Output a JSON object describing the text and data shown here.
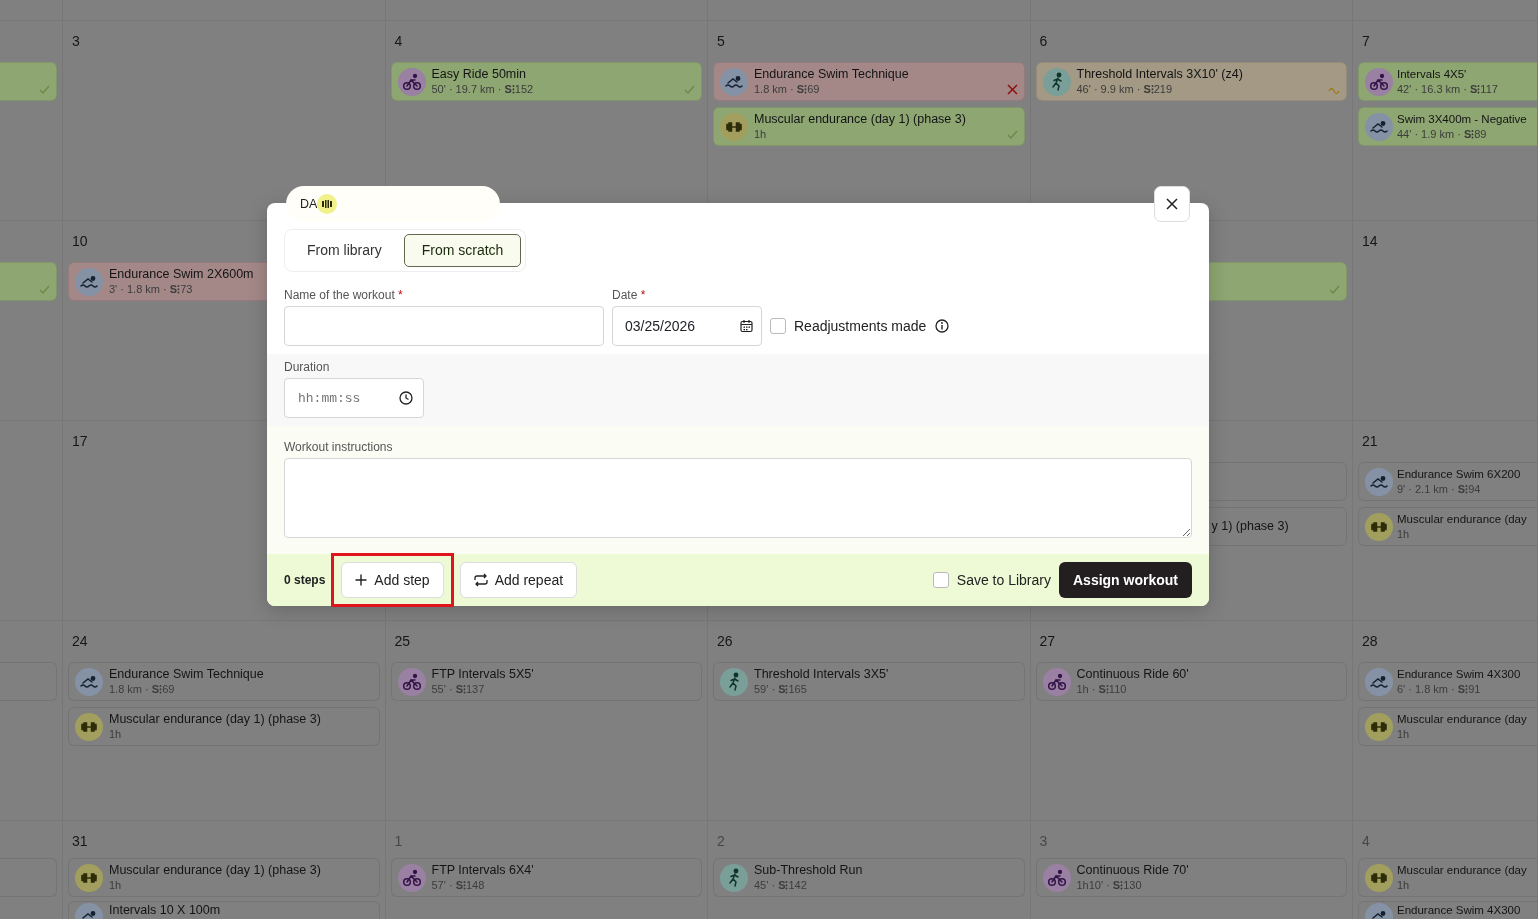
{
  "calendar": {
    "weeks": [
      {
        "column_1": {
          "workouts": [
            {
              "color": "#8ea672",
              "completed": true,
              "missed": false,
              "partial": false
            }
          ]
        },
        "column_2": {
          "number": "3",
          "other_month": false
        },
        "column_3": {
          "number": "4",
          "other_month": false,
          "workouts": [
            {
              "kind": "bike",
              "title": "Easy Ride 50min",
              "meta": "50' · 19.7 km · **S⁝**152",
              "color": "#8ea672",
              "completed": true,
              "missed": false,
              "partial": false
            }
          ]
        },
        "column_4": {
          "number": "5",
          "other_month": false,
          "workouts": [
            {
              "kind": "swim",
              "title": "Endurance Swim Technique",
              "meta": "1.8 km · **S⁝**69",
              "color": "#a48888",
              "completed": false,
              "missed": true,
              "partial": false
            },
            {
              "kind": "strength",
              "title": "Muscular endurance (day 1) (phase 3)",
              "meta": "1h",
              "color": "#8ea672",
              "completed": true,
              "missed": false,
              "partial": false
            }
          ]
        },
        "column_5": {
          "number": "6",
          "other_month": false,
          "workouts": [
            {
              "kind": "run",
              "title": "Threshold Intervals 3X10' (z4)",
              "meta": "46' · 9.9 km · **S⁝**219",
              "color": "#a39984",
              "completed": false,
              "missed": false,
              "partial": true
            }
          ]
        },
        "column_6": {
          "number": "7",
          "other_month": false,
          "workouts": [
            {
              "kind": "bike",
              "title": "Intervals 4X5'",
              "meta": "42' · 16.3 km · **S⁝**117",
              "color": "#8ea672",
              "completed": false,
              "missed": false,
              "partial": false
            },
            {
              "kind": "swim",
              "title": "Swim 3X400m - Negative",
              "meta": "44' · 1.9 km · **S⁝**89",
              "color": "#8ea672",
              "completed": false,
              "missed": false,
              "partial": false
            }
          ]
        }
      },
      {
        "column_1": {
          "workouts": [
            {
              "color": "#8ea672",
              "completed": true,
              "missed": false,
              "partial": false
            }
          ]
        },
        "column_2": {
          "number": "10",
          "other_month": false,
          "workouts": [
            {
              "kind": "swim",
              "title": "Endurance Swim 2X600m",
              "meta": "3' · 1.8 km · **S⁝**73",
              "color": "#a48888",
              "completed": false,
              "missed": false,
              "partial": false
            }
          ]
        },
        "column_5": {
          "workouts": [
            {
              "kind": "covered",
              "color": "#8ea672",
              "completed": true,
              "missed": false,
              "partial": false
            }
          ]
        },
        "column_6": {
          "number": "14",
          "other_month": false
        }
      },
      {
        "column_2": {
          "number": "17",
          "other_month": false
        },
        "column_5": {
          "workouts": [
            {
              "kind": "covered",
              "color": "#808080",
              "completed": false,
              "missed": false,
              "partial": false
            },
            {
              "kind": "covered",
              "title": "y 1) (phase 3)",
              "color": "#808080",
              "completed": false,
              "missed": false,
              "partial": false
            }
          ]
        },
        "column_6": {
          "number": "21",
          "other_month": false,
          "workouts": [
            {
              "kind": "swim",
              "title": "Endurance Swim 6X200",
              "meta": "9' · 2.1 km · **S⁝**94",
              "color": "#808080",
              "completed": false,
              "missed": false,
              "partial": false
            },
            {
              "kind": "strength",
              "title": "Muscular endurance (day",
              "meta": "1h",
              "color": "#808080",
              "completed": false,
              "missed": false,
              "partial": false
            }
          ]
        }
      },
      {
        "column_1": {
          "workouts": [
            {
              "color": "#808080",
              "completed": false,
              "missed": false,
              "partial": false
            }
          ]
        },
        "column_2": {
          "number": "24",
          "other_month": false,
          "workouts": [
            {
              "kind": "swim",
              "title": "Endurance Swim Technique",
              "meta": "1.8 km · **S⁝**69",
              "color": "#808080",
              "completed": false,
              "missed": false,
              "partial": false
            },
            {
              "kind": "strength",
              "title": "Muscular endurance (day 1) (phase 3)",
              "meta": "1h",
              "color": "#808080",
              "completed": false,
              "missed": false,
              "partial": false
            }
          ]
        },
        "column_3": {
          "number": "25",
          "other_month": false,
          "workouts": [
            {
              "kind": "bike",
              "title": "FTP Intervals 5X5'",
              "meta": "55' · **S⁝**137",
              "color": "#808080",
              "completed": false,
              "missed": false,
              "partial": false
            }
          ]
        },
        "column_4": {
          "number": "26",
          "other_month": false,
          "workouts": [
            {
              "kind": "run",
              "title": "Threshold Intervals 3X5'",
              "meta": "59' · **S⁝**165",
              "color": "#808080",
              "completed": false,
              "missed": false,
              "partial": false
            }
          ]
        },
        "column_5": {
          "number": "27",
          "other_month": false,
          "workouts": [
            {
              "kind": "bike",
              "title": "Continuous Ride 60'",
              "meta": "1h · **S⁝**110",
              "color": "#808080",
              "completed": false,
              "missed": false,
              "partial": false
            }
          ]
        },
        "column_6": {
          "number": "28",
          "other_month": false,
          "workouts": [
            {
              "kind": "swim",
              "title": "Endurance Swim 4X300",
              "meta": "6' · 1.8 km · **S⁝**91",
              "color": "#808080",
              "completed": false,
              "missed": false,
              "partial": false
            },
            {
              "kind": "strength",
              "title": "Muscular endurance (day",
              "meta": "1h",
              "color": "#808080",
              "completed": false,
              "missed": false,
              "partial": false
            }
          ]
        }
      },
      {
        "column_1": {
          "workouts": [
            {
              "color": "#808080",
              "completed": false,
              "missed": false,
              "partial": false
            }
          ]
        },
        "column_2": {
          "number": "31",
          "other_month": false,
          "workouts": [
            {
              "kind": "strength",
              "title": "Muscular endurance (day 1) (phase 3)",
              "meta": "1h",
              "color": "#808080",
              "completed": false,
              "missed": false,
              "partial": false
            },
            {
              "kind": "swim",
              "title": "Intervals 10 X 100m",
              "color": "#808080",
              "completed": false,
              "missed": false,
              "partial": false
            }
          ]
        },
        "column_3": {
          "number": "1",
          "other_month": true,
          "workouts": [
            {
              "kind": "bike",
              "title": "FTP Intervals 6X4'",
              "meta": "57' · **S⁝**148",
              "color": "#808080",
              "completed": false,
              "missed": false,
              "partial": false
            }
          ]
        },
        "column_4": {
          "number": "2",
          "other_month": true,
          "workouts": [
            {
              "kind": "run",
              "title": "Sub-Threshold Run",
              "meta": "45' · **S⁝**142",
              "color": "#808080",
              "completed": false,
              "missed": false,
              "partial": false
            }
          ]
        },
        "column_5": {
          "number": "3",
          "other_month": true,
          "workouts": [
            {
              "kind": "bike",
              "title": "Continuous Ride 70'",
              "meta": "1h10' · **S⁝**130",
              "color": "#808080",
              "completed": false,
              "missed": false,
              "partial": false
            }
          ]
        },
        "column_6": {
          "number": "4",
          "other_month": true,
          "workouts": [
            {
              "kind": "strength",
              "title": "Muscular endurance (day",
              "meta": "1h",
              "color": "#808080",
              "completed": false,
              "missed": false,
              "partial": false
            },
            {
              "kind": "swim",
              "title": "Endurance Swim 4X300",
              "color": "#808080",
              "completed": false,
              "missed": false,
              "partial": false
            }
          ]
        }
      }
    ]
  },
  "dialog": {
    "athlete_tab": {
      "initials": "DA"
    },
    "source_tabs": [
      {
        "label": "From library",
        "selected": false
      },
      {
        "label": "From scratch",
        "selected": true
      }
    ],
    "name_field": {
      "label": "Name of the workout",
      "required_mark": "*"
    },
    "date_field": {
      "label": "Date",
      "required_mark": "*",
      "value": "03/25/2026"
    },
    "readjustments": {
      "label": "Readjustments made",
      "checked": false
    },
    "duration_field": {
      "label": "Duration",
      "placeholder": "hh:mm:ss"
    },
    "instructions_field": {
      "label": "Workout instructions"
    },
    "footer": {
      "step_count": "0 steps",
      "add_step": {
        "label": "Add step",
        "highlighted": true
      },
      "add_repeat": {
        "label": "Add repeat"
      },
      "save_to_library": {
        "label": "Save to Library",
        "checked": false
      },
      "assign": {
        "label": "Assign workout"
      }
    }
  }
}
